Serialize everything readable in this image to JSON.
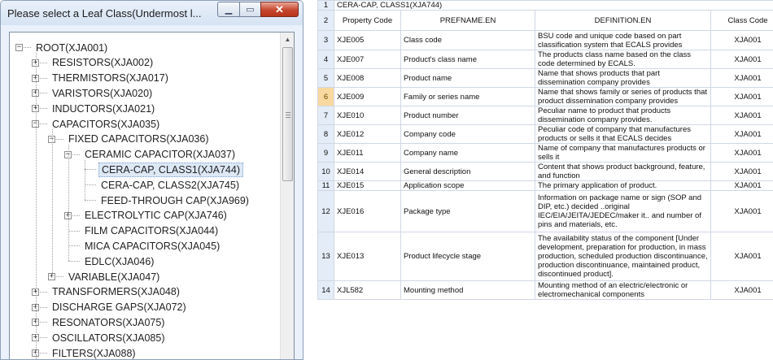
{
  "dialog": {
    "title": "Please select a Leaf Class(Undermost l...",
    "minimize_glyph": "▁",
    "maximize_glyph": "▭",
    "close_glyph": "✕"
  },
  "tree": [
    {
      "label": "ROOT(XJA001)",
      "level": 0,
      "expander": "−"
    },
    {
      "label": "RESISTORS(XJA002)",
      "level": 1,
      "expander": "+"
    },
    {
      "label": "THERMISTORS(XJA017)",
      "level": 1,
      "expander": "+"
    },
    {
      "label": "VARISTORS(XJA020)",
      "level": 1,
      "expander": "+"
    },
    {
      "label": "INDUCTORS(XJA021)",
      "level": 1,
      "expander": "+"
    },
    {
      "label": "CAPACITORS(XJA035)",
      "level": 1,
      "expander": "−"
    },
    {
      "label": "FIXED CAPACITORS(XJA036)",
      "level": 2,
      "expander": "−"
    },
    {
      "label": "CERAMIC CAPACITOR(XJA037)",
      "level": 3,
      "expander": "−"
    },
    {
      "label": "CERA-CAP, CLASS1(XJA744)",
      "level": 4,
      "expander": "",
      "selected": true
    },
    {
      "label": "CERA-CAP, CLASS2(XJA745)",
      "level": 4,
      "expander": ""
    },
    {
      "label": "FEED-THROUGH CAP(XJA969)",
      "level": 4,
      "expander": ""
    },
    {
      "label": "ELECTROLYTIC CAP(XJA746)",
      "level": 3,
      "expander": "+"
    },
    {
      "label": "FILM CAPACITORS(XJA044)",
      "level": 3,
      "expander": ""
    },
    {
      "label": "MICA CAPACITORS(XJA045)",
      "level": 3,
      "expander": ""
    },
    {
      "label": "EDLC(XJA046)",
      "level": 3,
      "expander": ""
    },
    {
      "label": "VARIABLE(XJA047)",
      "level": 2,
      "expander": "+"
    },
    {
      "label": "TRANSFORMERS(XJA048)",
      "level": 1,
      "expander": "+"
    },
    {
      "label": "DISCHARGE GAPS(XJA072)",
      "level": 1,
      "expander": "+"
    },
    {
      "label": "RESONATORS(XJA075)",
      "level": 1,
      "expander": "+"
    },
    {
      "label": "OSCILLATORS(XJA085)",
      "level": 1,
      "expander": "+"
    },
    {
      "label": "FILTERS(XJA088)",
      "level": 1,
      "expander": "+"
    }
  ],
  "sheet": {
    "row1": {
      "num": "1",
      "text": "CERA-CAP, CLASS1(XJA744)"
    },
    "headers": {
      "num": "2",
      "code": "Property Code",
      "prefname": "PREFNAME.EN",
      "definition": "DEFINITION.EN",
      "classcode": "Class Code"
    },
    "rows": [
      {
        "num": "3",
        "code": "XJE005",
        "name": "Class code",
        "def": "BSU code and unique code based on part classification system that ECALS provides",
        "cls": "XJA001"
      },
      {
        "num": "4",
        "code": "XJE007",
        "name": "Product's class name",
        "def": "The products class name based on the class code determined by ECALS.",
        "cls": "XJA001"
      },
      {
        "num": "5",
        "code": "XJE008",
        "name": "Product name",
        "def": "Name that shows products that part dissemination company provides",
        "cls": "XJA001"
      },
      {
        "num": "6",
        "code": "XJE009",
        "name": "Family or series name",
        "def": "Name that shows family or series of products that product dissemination company provides",
        "cls": "XJA001",
        "active": true
      },
      {
        "num": "7",
        "code": "XJE010",
        "name": "Product number",
        "def": "Peculiar name to product that products dissemination company provides.",
        "cls": "XJA001"
      },
      {
        "num": "8",
        "code": "XJE012",
        "name": "Company code",
        "def": "Peculiar code of company that manufactures products or sells it that ECALS decides",
        "cls": "XJA001"
      },
      {
        "num": "9",
        "code": "XJE011",
        "name": "Company name",
        "def": "Name of company that manufactures products or sells it",
        "cls": "XJA001"
      },
      {
        "num": "10",
        "code": "XJE014",
        "name": "General description",
        "def": "Content that shows product background, feature, and function",
        "cls": "XJA001"
      },
      {
        "num": "11",
        "code": "XJE015",
        "name": "Application scope",
        "def": "The primary application of product.",
        "cls": "XJA001"
      },
      {
        "num": "12",
        "code": "XJE016",
        "name": "Package type",
        "def": "Information on package name or sign (SOP and DIP, etc.) decided ..original IEC/EIA/JEITA/JEDEC/maker it.. and number of pins and materials, etc.",
        "cls": "XJA001"
      },
      {
        "num": "13",
        "code": "XJE013",
        "name": "Product lifecycle stage",
        "def": "The availability status of the component [Under development, preparation for production, in mass production, scheduled production discontinuance, production discontinuance, maintained product, discontinued product].",
        "cls": "XJA001"
      },
      {
        "num": "14",
        "code": "XJL582",
        "name": "Mounting method",
        "def": "Mounting method of an electric/electronic or electromechanical components",
        "cls": "XJA001"
      }
    ]
  }
}
